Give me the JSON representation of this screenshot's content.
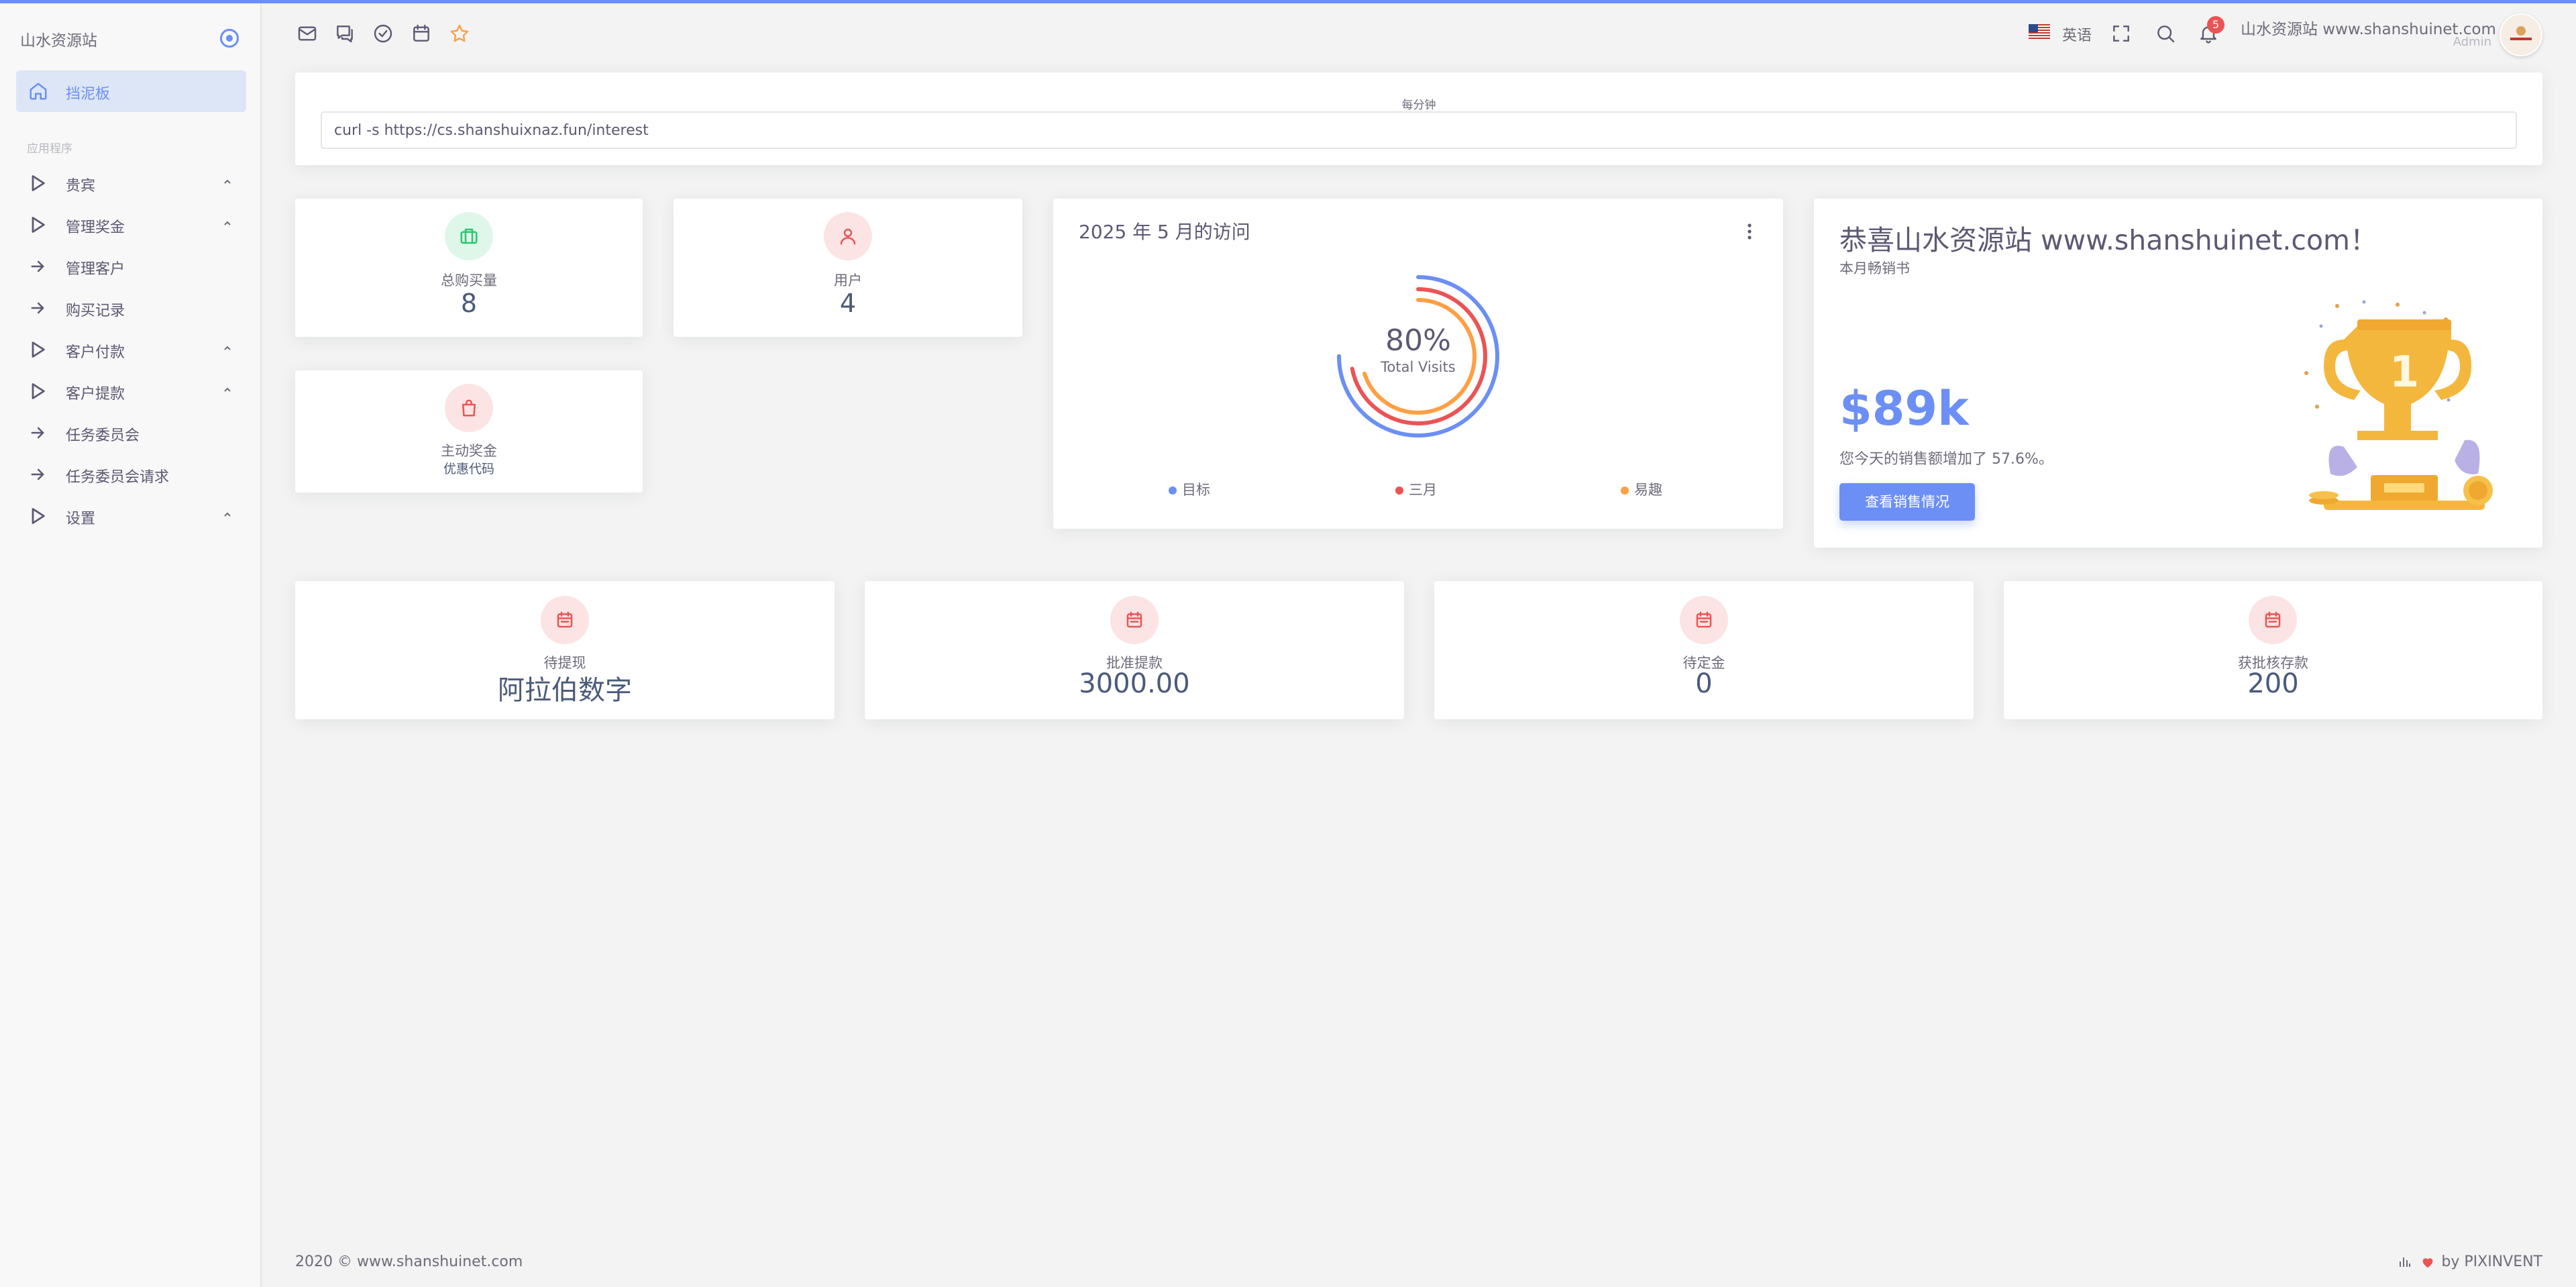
{
  "app": {
    "brand": "山水资源站",
    "accent_color": "#6c8ff5"
  },
  "sidebar": {
    "active_item": {
      "label": "挡泥板",
      "icon": "home-icon"
    },
    "section_label": "应用程序",
    "items": [
      {
        "label": "贵宾",
        "icon": "play-icon",
        "expandable": true
      },
      {
        "label": "管理奖金",
        "icon": "play-icon",
        "expandable": true
      },
      {
        "label": "管理客户",
        "icon": "arrow-right-icon",
        "expandable": false
      },
      {
        "label": "购买记录",
        "icon": "arrow-right-icon",
        "expandable": false
      },
      {
        "label": "客户付款",
        "icon": "play-icon",
        "expandable": true
      },
      {
        "label": "客户提款",
        "icon": "play-icon",
        "expandable": true
      },
      {
        "label": "任务委员会",
        "icon": "arrow-right-icon",
        "expandable": false
      },
      {
        "label": "任务委员会请求",
        "icon": "arrow-right-icon",
        "expandable": false
      },
      {
        "label": "设置",
        "icon": "play-icon",
        "expandable": true
      }
    ]
  },
  "topbar": {
    "shortcut_icons": [
      "mail-icon",
      "chat-icon",
      "check-circle-icon",
      "calendar-icon",
      "star-icon"
    ],
    "language": "英语",
    "notification_count": "5",
    "user_name": "山水资源站 www.shanshuinet.com",
    "user_role": "Admin"
  },
  "cron": {
    "caption": "每分钟",
    "command": "curl -s https://cs.shanshuixnaz.fun/interest"
  },
  "stats_small": [
    {
      "label": "总购买量",
      "value": "8",
      "icon": "briefcase-icon",
      "color": "#28c76f",
      "bg": "#dff7e9"
    },
    {
      "label": "用户",
      "value": "4",
      "icon": "user-icon",
      "color": "#ea5455",
      "bg": "#fce4e4"
    },
    {
      "label": "主动奖金",
      "value": "优惠代码",
      "icon": "bag-icon",
      "color": "#ea5455",
      "bg": "#fce4e4"
    }
  ],
  "visits": {
    "title": "2025 年 5 月的访问",
    "center_value": "80%",
    "center_label": "Total Visits",
    "legend": [
      {
        "label": "目标",
        "color": "#6c8ff5"
      },
      {
        "label": "三月",
        "color": "#ea5455"
      },
      {
        "label": "易趣",
        "color": "#ff9f43"
      }
    ],
    "rings": [
      {
        "name": "目标",
        "fraction": 0.75,
        "color": "#6c8ff5"
      },
      {
        "name": "三月",
        "fraction": 0.72,
        "color": "#ea5455"
      },
      {
        "name": "易趣",
        "fraction": 0.7,
        "color": "#ff9f43"
      }
    ]
  },
  "congrats": {
    "title": "恭喜山水资源站 www.shanshuinet.com！",
    "subtitle": "本月畅销书",
    "amount": "$89k",
    "description": "您今天的销售额增加了 57.6%。",
    "button_label": "查看销售情况",
    "trophy_rank": "1"
  },
  "stats_wide": [
    {
      "label": "待提现",
      "value": "阿拉伯数字",
      "icon": "calendar-icon"
    },
    {
      "label": "批准提款",
      "value": "3000.00",
      "icon": "calendar-icon"
    },
    {
      "label": "待定金",
      "value": "0",
      "icon": "calendar-icon"
    },
    {
      "label": "获批核存款",
      "value": "200",
      "icon": "calendar-icon"
    }
  ],
  "footer": {
    "copyright": "2020 © www.shanshuinet.com",
    "credit": "by PIXINVENT"
  }
}
